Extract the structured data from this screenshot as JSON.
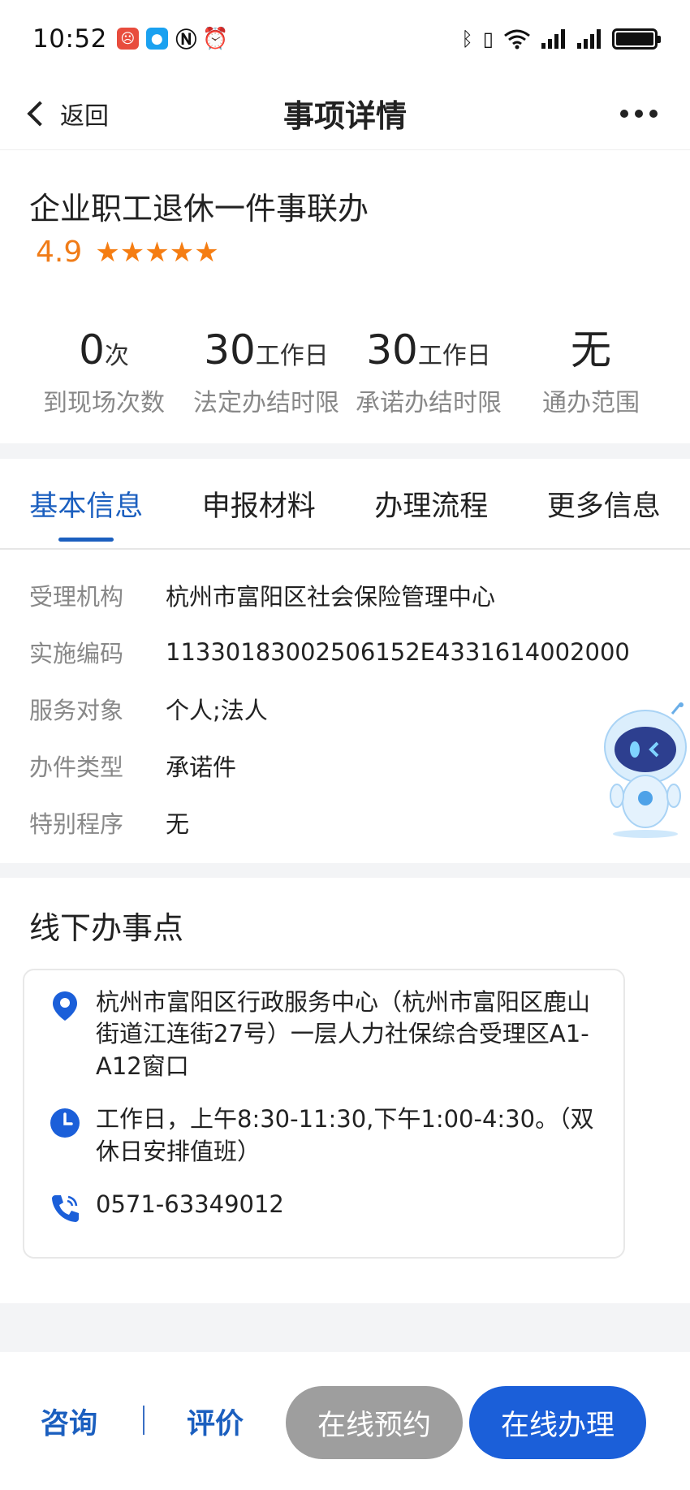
{
  "status_bar": {
    "time": "10:52",
    "left_icons": [
      "app-notification-icon",
      "message-icon",
      "nfc-icon",
      "alarm-icon"
    ],
    "right_icons": [
      "bluetooth-icon",
      "vibrate-icon",
      "wifi-icon",
      "signal-icon",
      "signal-icon",
      "battery-icon"
    ]
  },
  "nav": {
    "back_label": "返回",
    "title": "事项详情"
  },
  "item": {
    "title": "企业职工退休一件事联办",
    "rating": "4.9",
    "stars": "★★★★★",
    "stars_count": 5
  },
  "stats": [
    {
      "value": "0",
      "unit": "次",
      "label": "到现场次数"
    },
    {
      "value": "30",
      "unit": "工作日",
      "label": "法定办结时限"
    },
    {
      "value": "30",
      "unit": "工作日",
      "label": "承诺办结时限"
    },
    {
      "value": "无",
      "unit": "",
      "label": "通办范围"
    }
  ],
  "tabs": [
    {
      "label": "基本信息",
      "active": true
    },
    {
      "label": "申报材料",
      "active": false
    },
    {
      "label": "办理流程",
      "active": false
    },
    {
      "label": "更多信息",
      "active": false
    }
  ],
  "basic_info": [
    {
      "label": "受理机构",
      "value": "杭州市富阳区社会保险管理中心"
    },
    {
      "label": "实施编码",
      "value": "11330183002506152E4331614002000"
    },
    {
      "label": "服务对象",
      "value": "个人;法人"
    },
    {
      "label": "办件类型",
      "value": "承诺件"
    },
    {
      "label": "特别程序",
      "value": "无"
    }
  ],
  "offline": {
    "title": "线下办事点",
    "address": "杭州市富阳区行政服务中心（杭州市富阳区鹿山街道江连街27号）一层人力社保综合受理区A1-A12窗口",
    "hours": "工作日，上午8:30-11:30,下午1:00-4:30。（双休日安排值班）",
    "phone": "0571-63349012"
  },
  "bottom": {
    "consult": "咨询",
    "divider": "|",
    "evaluate": "评价",
    "appoint": "在线预约",
    "handle": "在线办理"
  },
  "colors": {
    "accent": "#1b5fbf",
    "rating": "#f07c18",
    "disabled_button": "#9e9e9e",
    "primary_button": "#1b5fd9"
  }
}
